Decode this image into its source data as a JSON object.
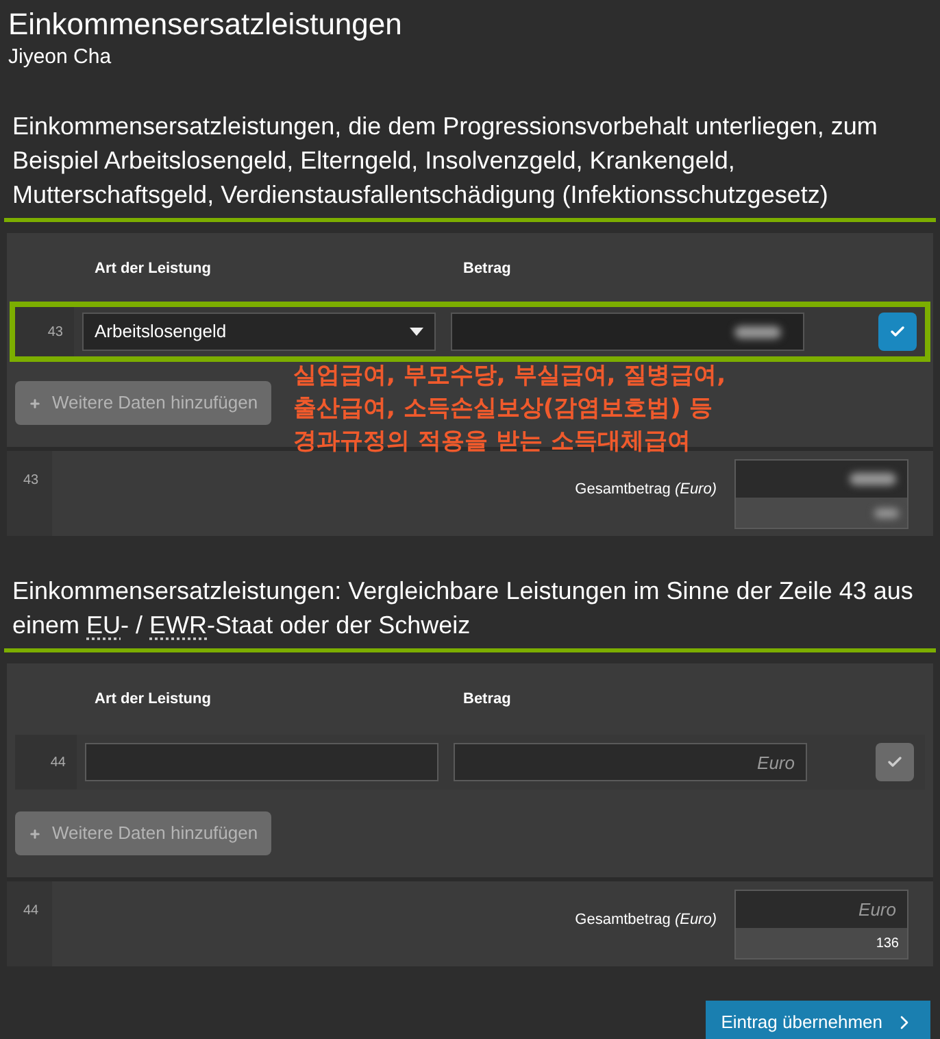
{
  "title": "Einkommensersatzleistungen",
  "subtitle": "Jiyeon Cha",
  "sections": [
    {
      "heading": [
        {
          "text": "Einkommensersatzleistungen, die dem Progressionsvorbehalt unterliegen, zum Beispiel Arbeitslosengeld, Elterngeld, Insolvenzgeld, Krankengeld, Mutterschaftsgeld, Verdienstausfallentschädigung (Infektionsschutzgesetz)",
          "abbr": false
        }
      ],
      "columns": [
        "Art der Leistung",
        "Betrag"
      ],
      "rows": [
        {
          "line": "43",
          "type": "Arbeitslosengeld",
          "amount": {
            "redacted": true
          },
          "disabled": false,
          "highlighted": true
        }
      ],
      "add_button": "Weitere Daten hinzufügen",
      "total": {
        "line": "43",
        "label": "Gesamtbetrag *(Euro)*",
        "value": {
          "redacted": true
        },
        "sub_value": {
          "redacted": true
        }
      }
    },
    {
      "heading": [
        {
          "text": "Einkommensersatzleistungen: Vergleichbare Leistungen im Sinne der Zeile 43 aus einem ",
          "abbr": false
        },
        {
          "text": "EU",
          "abbr": true
        },
        {
          "text": "- / ",
          "abbr": false
        },
        {
          "text": "EWR",
          "abbr": true
        },
        {
          "text": "-Staat oder der Schweiz",
          "abbr": false
        }
      ],
      "columns": [
        "Art der Leistung",
        "Betrag"
      ],
      "rows": [
        {
          "line": "44",
          "amount": {
            "redacted": false,
            "placeholder": "Euro"
          },
          "disabled": true,
          "highlighted": false
        }
      ],
      "add_button": "Weitere Daten hinzufügen",
      "total": {
        "line": "44",
        "label": "Gesamtbetrag *(Euro)*",
        "value": {
          "redacted": false,
          "placeholder": "Euro"
        },
        "sub_value": {
          "redacted": false,
          "text": "136"
        }
      }
    }
  ],
  "annotation": [
    "실업급여, 부모수당, 부실급여, 질병급여,",
    "출산급여, 소득손실보상(감염보호법) 등",
    "경과규정의 적용을 받는 소득대체급여"
  ],
  "submit_button": "Eintrag übernehmen"
}
